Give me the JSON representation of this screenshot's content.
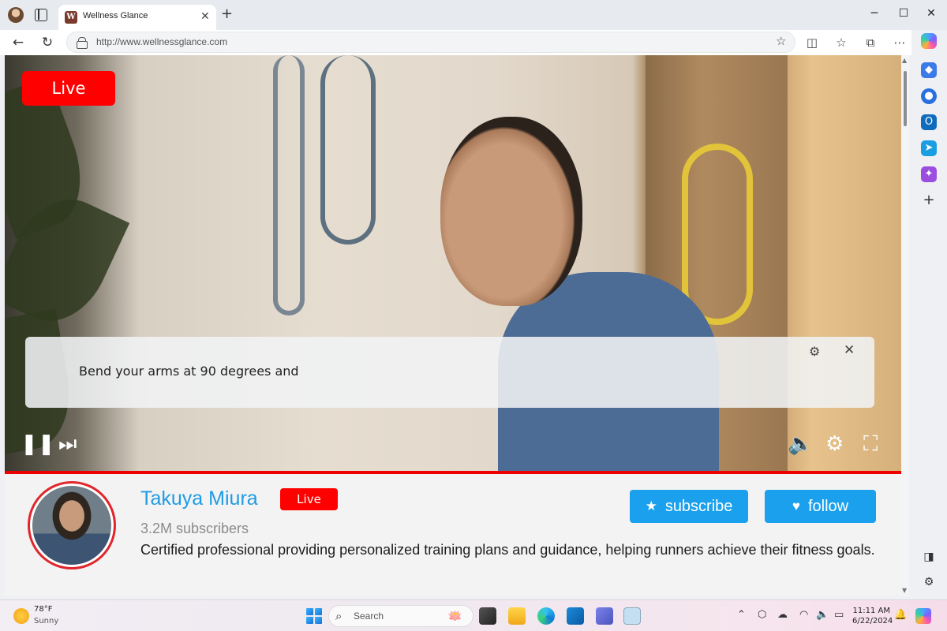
{
  "browser": {
    "tab_title": "Wellness Glance",
    "tab_favicon_letter": "W",
    "url": "http://www.wellnessglance.com",
    "window_controls": {
      "minimize": "─",
      "maximize": "☐",
      "close": "✕"
    }
  },
  "video": {
    "live_badge": "Live",
    "caption": "Bend your arms at 90 degrees and",
    "progress": 1.0
  },
  "channel": {
    "name": "Takuya Miura",
    "live_label": "Live",
    "subscribers": "3.2M subscribers",
    "description": "Certified professional providing personalized training plans and guidance, helping runners achieve their fitness goals.",
    "subscribe_label": "subscribe",
    "follow_label": "follow"
  },
  "taskbar": {
    "temperature": "78°F",
    "condition": "Sunny",
    "search_placeholder": "Search",
    "time": "11:11 AM",
    "date": "6/22/2024"
  },
  "colors": {
    "live_red": "#ff0000",
    "accent_blue": "#1aa0ec",
    "channel_name": "#1f9be3"
  }
}
